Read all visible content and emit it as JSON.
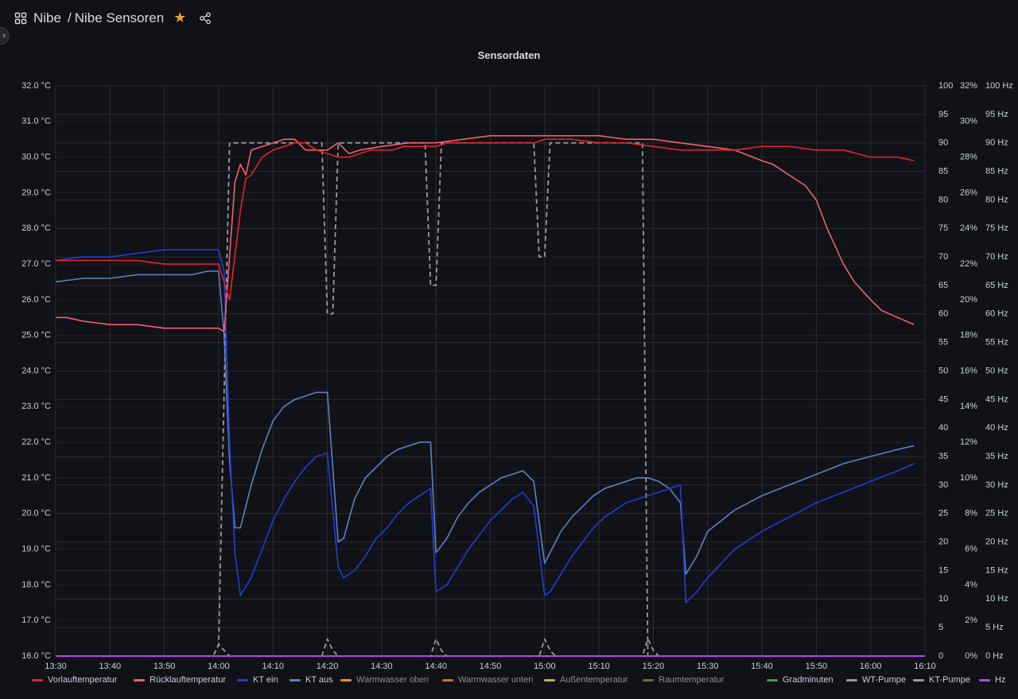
{
  "header": {
    "breadcrumb_parent": "Nibe",
    "breadcrumb_sep": "/",
    "breadcrumb_title": "Nibe Sensoren",
    "icons": [
      "apps-icon",
      "star-icon",
      "share-icon"
    ]
  },
  "colors": {
    "background": "#111217",
    "grid": "#2a2c33",
    "axis_text": "#c7d0d9",
    "vorlauf": "#e0252a",
    "ruecklauf": "#f2616b",
    "kt_ein": "#1f3ed6",
    "kt_aus": "#5b82c4",
    "pump": "#9a9a9a",
    "hz": "#b445e6",
    "warmwasser_oben": "#ff8a2b",
    "warmwasser_unten": "#e06a17",
    "aussen": "#c7b34a",
    "raum": "#7a6a22",
    "gradminuten": "#37a72f",
    "wt_pumpe": "#9a9a9a",
    "kt_pumpe": "#9a9a9a"
  },
  "chart_data": {
    "type": "line",
    "title": "Sensordaten",
    "x_ticks": [
      "13:30",
      "13:40",
      "13:50",
      "14:00",
      "14:10",
      "14:20",
      "14:30",
      "14:40",
      "14:50",
      "15:00",
      "15:10",
      "15:20",
      "15:30",
      "15:40",
      "15:50",
      "16:00",
      "16:10"
    ],
    "x_range_minutes": [
      0,
      160
    ],
    "y_left": {
      "range": [
        16,
        32
      ],
      "ticks": [
        "16.0 °C",
        "17.0 °C",
        "18.0 °C",
        "19.0 °C",
        "20.0 °C",
        "21.0 °C",
        "22.0 °C",
        "23.0 °C",
        "24.0 °C",
        "25.0 °C",
        "26.0 °C",
        "27.0 °C",
        "28.0 °C",
        "29.0 °C",
        "30.0 °C",
        "31.0 °C",
        "32.0 °C"
      ]
    },
    "y_right1": {
      "range": [
        0,
        100
      ],
      "ticks": [
        "0",
        "5",
        "10",
        "15",
        "20",
        "25",
        "30",
        "35",
        "40",
        "45",
        "50",
        "55",
        "60",
        "65",
        "70",
        "75",
        "80",
        "85",
        "90",
        "95",
        "100"
      ]
    },
    "y_right2": {
      "range": [
        0,
        32
      ],
      "ticks": [
        "0%",
        "2%",
        "4%",
        "6%",
        "8%",
        "10%",
        "12%",
        "14%",
        "16%",
        "18%",
        "20%",
        "22%",
        "24%",
        "26%",
        "28%",
        "30%",
        "32%"
      ]
    },
    "y_right3": {
      "range": [
        0,
        100
      ],
      "ticks": [
        "0 Hz",
        "5 Hz",
        "10 Hz",
        "15 Hz",
        "20 Hz",
        "25 Hz",
        "30 Hz",
        "35 Hz",
        "40 Hz",
        "45 Hz",
        "50 Hz",
        "55 Hz",
        "60 Hz",
        "65 Hz",
        "70 Hz",
        "75 Hz",
        "80 Hz",
        "85 Hz",
        "90 Hz",
        "95 Hz",
        "100 Hz"
      ]
    },
    "legend": [
      "Vorlauftemperatur",
      "Rücklauftemperatur",
      "KT ein",
      "KT aus",
      "Warmwasser oben",
      "Warmwasser unten",
      "Außentemperatur",
      "Raumtemperatur",
      "Gradminuten",
      "WT-Pumpe",
      "KT-Pumpe",
      "Hz"
    ],
    "series": [
      {
        "name": "Vorlauftemperatur",
        "axis": "left",
        "color_key": "vorlauf",
        "x": [
          0,
          10,
          15,
          20,
          30,
          31,
          32,
          34,
          35,
          36,
          38,
          40,
          42,
          44,
          46,
          48,
          50,
          52,
          54,
          56,
          58,
          60,
          62,
          64,
          66,
          68,
          70,
          72,
          74,
          76,
          78,
          80,
          82,
          84,
          86,
          88,
          90,
          92,
          95,
          100,
          105,
          110,
          115,
          120,
          125,
          130,
          135,
          140,
          145,
          150,
          155,
          158
        ],
        "y": [
          27.1,
          27.1,
          27.1,
          27.0,
          27.0,
          26.5,
          26.0,
          28.5,
          29.4,
          29.5,
          30.0,
          30.2,
          30.3,
          30.4,
          30.4,
          30.2,
          30.1,
          30.0,
          30.0,
          30.1,
          30.2,
          30.2,
          30.2,
          30.3,
          30.3,
          30.3,
          30.3,
          30.4,
          30.4,
          30.4,
          30.4,
          30.4,
          30.4,
          30.4,
          30.4,
          30.4,
          30.5,
          30.5,
          30.5,
          30.4,
          30.4,
          30.3,
          30.2,
          30.2,
          30.2,
          30.3,
          30.3,
          30.2,
          30.2,
          30.0,
          30.0,
          29.9
        ]
      },
      {
        "name": "Rücklauftemperatur",
        "axis": "left",
        "color_key": "ruecklauf",
        "x": [
          0,
          2,
          5,
          10,
          15,
          20,
          25,
          30,
          31,
          33,
          34,
          35,
          36,
          38,
          40,
          42,
          44,
          46,
          48,
          50,
          52,
          54,
          56,
          60,
          65,
          70,
          75,
          80,
          85,
          90,
          95,
          100,
          105,
          110,
          115,
          120,
          125,
          130,
          132,
          135,
          138,
          140,
          142,
          145,
          147,
          150,
          152,
          155,
          158
        ],
        "y": [
          25.5,
          25.5,
          25.4,
          25.3,
          25.3,
          25.2,
          25.2,
          25.2,
          25.1,
          29.3,
          29.8,
          29.5,
          30.2,
          30.3,
          30.4,
          30.5,
          30.5,
          30.2,
          30.2,
          30.2,
          30.4,
          30.1,
          30.2,
          30.3,
          30.4,
          30.4,
          30.5,
          30.6,
          30.6,
          30.6,
          30.6,
          30.6,
          30.5,
          30.5,
          30.4,
          30.3,
          30.2,
          29.9,
          29.8,
          29.5,
          29.2,
          28.8,
          28.0,
          27.0,
          26.5,
          26.0,
          25.7,
          25.5,
          25.3
        ]
      },
      {
        "name": "KT ein",
        "axis": "left",
        "color_key": "kt_ein",
        "x": [
          0,
          5,
          10,
          15,
          20,
          25,
          28,
          30,
          31,
          32,
          33,
          34,
          36,
          38,
          40,
          42,
          44,
          46,
          48,
          50,
          52,
          53,
          55,
          57,
          59,
          61,
          63,
          65,
          67,
          69,
          70,
          72,
          74,
          76,
          78,
          80,
          82,
          84,
          86,
          88,
          90,
          91,
          93,
          95,
          97,
          99,
          101,
          103,
          105,
          107,
          109,
          111,
          113,
          115,
          116,
          118,
          120,
          125,
          130,
          135,
          140,
          145,
          150,
          155,
          158
        ],
        "y": [
          27.1,
          27.2,
          27.2,
          27.3,
          27.4,
          27.4,
          27.4,
          27.4,
          26.8,
          22.0,
          18.9,
          17.7,
          18.2,
          19.0,
          19.8,
          20.4,
          20.9,
          21.3,
          21.6,
          21.7,
          18.5,
          18.2,
          18.4,
          18.8,
          19.3,
          19.6,
          20.0,
          20.3,
          20.5,
          20.7,
          17.8,
          18.0,
          18.5,
          19.0,
          19.4,
          19.8,
          20.1,
          20.4,
          20.6,
          20.2,
          17.7,
          17.8,
          18.3,
          18.8,
          19.2,
          19.6,
          19.9,
          20.1,
          20.3,
          20.4,
          20.5,
          20.6,
          20.7,
          20.8,
          17.5,
          17.8,
          18.2,
          19.0,
          19.5,
          19.9,
          20.3,
          20.6,
          20.9,
          21.2,
          21.4
        ]
      },
      {
        "name": "KT aus",
        "axis": "left",
        "color_key": "kt_aus",
        "x": [
          0,
          5,
          10,
          15,
          20,
          25,
          28,
          30,
          31,
          32,
          33,
          34,
          36,
          38,
          40,
          42,
          44,
          46,
          48,
          50,
          52,
          53,
          55,
          57,
          59,
          61,
          63,
          65,
          67,
          69,
          70,
          72,
          74,
          76,
          78,
          80,
          82,
          84,
          86,
          88,
          90,
          91,
          93,
          95,
          97,
          99,
          101,
          103,
          105,
          107,
          109,
          111,
          113,
          115,
          116,
          118,
          120,
          125,
          130,
          135,
          140,
          145,
          150,
          155,
          158
        ],
        "y": [
          26.5,
          26.6,
          26.6,
          26.7,
          26.7,
          26.7,
          26.8,
          26.8,
          25.0,
          21.5,
          19.6,
          19.6,
          20.8,
          21.8,
          22.6,
          23.0,
          23.2,
          23.3,
          23.4,
          23.4,
          19.2,
          19.3,
          20.4,
          21.0,
          21.3,
          21.6,
          21.8,
          21.9,
          22.0,
          22.0,
          18.9,
          19.3,
          19.9,
          20.3,
          20.6,
          20.8,
          21.0,
          21.1,
          21.2,
          20.9,
          18.6,
          18.9,
          19.5,
          19.9,
          20.2,
          20.5,
          20.7,
          20.8,
          20.9,
          21.0,
          21.0,
          20.9,
          20.7,
          20.3,
          18.3,
          18.8,
          19.5,
          20.1,
          20.5,
          20.8,
          21.1,
          21.4,
          21.6,
          21.8,
          21.9
        ]
      },
      {
        "name": "WT-Pumpe",
        "axis": "right1",
        "color_key": "pump",
        "dashed": true,
        "x": [
          0,
          29,
          30,
          32,
          33,
          35,
          49,
          50,
          51,
          52,
          54,
          68,
          69,
          70,
          71,
          73,
          88,
          89,
          90,
          91,
          93,
          108,
          109,
          110,
          111,
          112,
          160
        ],
        "y": [
          0,
          0,
          2,
          90,
          90,
          90,
          90,
          60,
          60,
          90,
          90,
          90,
          65,
          65,
          90,
          90,
          90,
          70,
          70,
          90,
          90,
          90,
          0,
          0,
          0,
          0,
          0
        ]
      },
      {
        "name": "KT-Pumpe",
        "axis": "right1",
        "color_key": "pump",
        "dashed": true,
        "x": [
          0,
          29,
          30,
          31,
          32,
          49,
          50,
          51,
          52,
          69,
          70,
          71,
          72,
          89,
          90,
          91,
          92,
          108,
          109,
          110,
          111,
          160
        ],
        "y": [
          0,
          0,
          2,
          1,
          0,
          0,
          3,
          1,
          0,
          0,
          3,
          1,
          0,
          0,
          3,
          1,
          0,
          0,
          3,
          1,
          0,
          0
        ]
      },
      {
        "name": "Hz",
        "axis": "right3",
        "color_key": "hz",
        "x": [
          0,
          160
        ],
        "y": [
          0,
          0
        ]
      }
    ]
  }
}
